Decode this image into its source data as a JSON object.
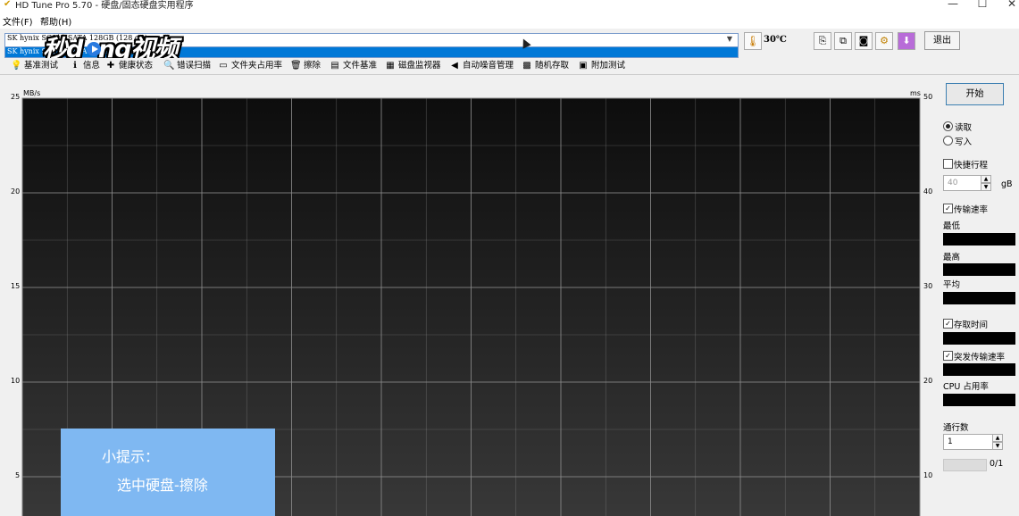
{
  "window": {
    "title": "HD Tune Pro 5.70 - 硬盘/固态硬盘实用程序",
    "controls": [
      "—",
      "☐",
      "✕"
    ]
  },
  "menu": [
    "文件(F)",
    "帮助(H)"
  ],
  "drive": {
    "selected": "SK hynix SC311 SATA 128GB (128 gB)",
    "dropdown_option": "SK hynix SC311 SATA 128GB (128 gB)"
  },
  "temperature": "30℃",
  "exit_label": "退出",
  "watermark": "秒懂视频",
  "tabs": [
    {
      "label": "基准测试",
      "icon": "benchmark-icon"
    },
    {
      "label": "信息",
      "icon": "info-icon"
    },
    {
      "label": "健康状态",
      "icon": "health-icon"
    },
    {
      "label": "错误扫描",
      "icon": "magnifier-icon"
    },
    {
      "label": "文件夹占用率",
      "icon": "folder-icon"
    },
    {
      "label": "擦除",
      "icon": "trash-icon"
    },
    {
      "label": "文件基准",
      "icon": "file-icon"
    },
    {
      "label": "磁盘监视器",
      "icon": "monitor-icon"
    },
    {
      "label": "自动噪音管理",
      "icon": "speaker-icon"
    },
    {
      "label": "随机存取",
      "icon": "random-icon"
    },
    {
      "label": "附加测试",
      "icon": "extra-icon"
    }
  ],
  "chart_data": {
    "type": "line",
    "title": "",
    "ylabel_left": "MB/s",
    "ylabel_right": "ms",
    "y_left_ticks": [
      "25",
      "20",
      "15",
      "10",
      "5"
    ],
    "y_right_ticks": [
      "50",
      "40",
      "30",
      "20",
      "10"
    ],
    "ylim_left": [
      0,
      25
    ],
    "ylim_right": [
      0,
      50
    ],
    "grid": true,
    "series": []
  },
  "side": {
    "start_label": "开始",
    "read_label": "读取",
    "write_label": "写入",
    "read_selected": true,
    "short_stroke_label": "快捷行程",
    "short_stroke_checked": false,
    "short_stroke_value": "40",
    "short_stroke_unit": "gB",
    "transfer_rate_label": "传输速率",
    "transfer_rate_checked": true,
    "min_label": "最低",
    "max_label": "最高",
    "avg_label": "平均",
    "access_time_label": "存取时间",
    "access_time_checked": true,
    "burst_rate_label": "突发传输速率",
    "burst_rate_checked": true,
    "cpu_label": "CPU 占用率",
    "passes_label": "通行数",
    "passes_value": "1",
    "progress_text": "0/1",
    "progress_fraction": 0
  },
  "tip": {
    "title": "小提示：",
    "body": "选中硬盘-擦除"
  },
  "colors": {
    "chart_bg_top": "#0d0d0d",
    "chart_bg_bottom": "#383838",
    "grid": "#8a8a8a",
    "tip_bg": "#7fb8f2",
    "selection": "#0078d7"
  }
}
